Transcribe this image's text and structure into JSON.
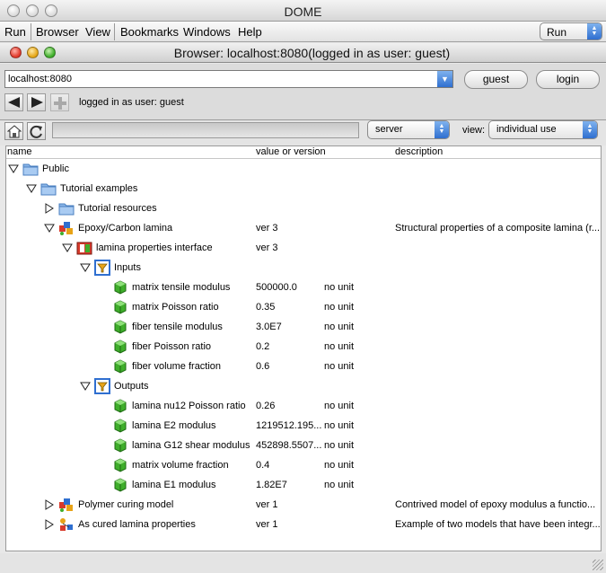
{
  "app": {
    "title": "DOME",
    "menus": [
      "Run",
      "Browser",
      "View",
      "Bookmarks",
      "Windows",
      "Help"
    ],
    "run_select": "Run"
  },
  "window": {
    "title": "Browser: localhost:8080(logged in as user: guest)"
  },
  "address_bar": {
    "value": "localhost:8080",
    "user_button": "guest",
    "login_button": "login",
    "status": "logged in as user: guest"
  },
  "toolbar": {
    "location_select": "server",
    "view_label": "view:",
    "view_select": "individual use"
  },
  "table": {
    "columns": [
      "name",
      "value or version",
      "description"
    ],
    "rows": [
      {
        "name": "Public",
        "icon": "folder-icon",
        "expanded": true
      },
      {
        "name": "Tutorial examples",
        "icon": "folder-icon",
        "expanded": true
      },
      {
        "name": "Tutorial resources",
        "icon": "folder-icon",
        "expanded": false
      },
      {
        "name": "Epoxy/Carbon lamina",
        "icon": "model-icon",
        "expanded": true,
        "value": "ver 3",
        "description": "Structural properties of a composite lamina (r..."
      },
      {
        "name": "lamina properties interface",
        "icon": "interface-icon",
        "expanded": true,
        "value": "ver 3"
      },
      {
        "name": "Inputs",
        "icon": "filter-icon",
        "expanded": true
      },
      {
        "name": "matrix tensile modulus",
        "icon": "parameter-cube-icon",
        "value": "500000.0",
        "unit": "no unit"
      },
      {
        "name": "matrix Poisson ratio",
        "icon": "parameter-cube-icon",
        "value": "0.35",
        "unit": "no unit"
      },
      {
        "name": "fiber tensile modulus",
        "icon": "parameter-cube-icon",
        "value": "3.0E7",
        "unit": "no unit"
      },
      {
        "name": "fiber Poisson ratio",
        "icon": "parameter-cube-icon",
        "value": "0.2",
        "unit": "no unit"
      },
      {
        "name": "fiber volume fraction",
        "icon": "parameter-cube-icon",
        "value": "0.6",
        "unit": "no unit"
      },
      {
        "name": "Outputs",
        "icon": "filter-icon",
        "expanded": true
      },
      {
        "name": "lamina nu12 Poisson ratio",
        "icon": "parameter-cube-icon",
        "value": "0.26",
        "unit": "no unit"
      },
      {
        "name": "lamina E2 modulus",
        "icon": "parameter-cube-icon",
        "value": "1219512.195...",
        "unit": "no unit"
      },
      {
        "name": "lamina G12 shear modulus",
        "icon": "parameter-cube-icon",
        "value": "452898.5507...",
        "unit": "no unit"
      },
      {
        "name": "matrix volume fraction",
        "icon": "parameter-cube-icon",
        "value": "0.4",
        "unit": "no unit"
      },
      {
        "name": "lamina E1 modulus",
        "icon": "parameter-cube-icon",
        "value": "1.82E7",
        "unit": "no unit"
      },
      {
        "name": "Polymer curing model",
        "icon": "model-icon",
        "expanded": false,
        "value": "ver 1",
        "description": "Contrived model  of epoxy modulus a functio..."
      },
      {
        "name": "As cured lamina properties",
        "icon": "playspace-icon",
        "expanded": false,
        "value": "ver 1",
        "description": "Example of two models that have been integr..."
      }
    ]
  },
  "colors": {
    "accent_blue": "#2f6fd0",
    "cube_green": "#3fae2b",
    "folder_blue": "#8bb6e8"
  }
}
